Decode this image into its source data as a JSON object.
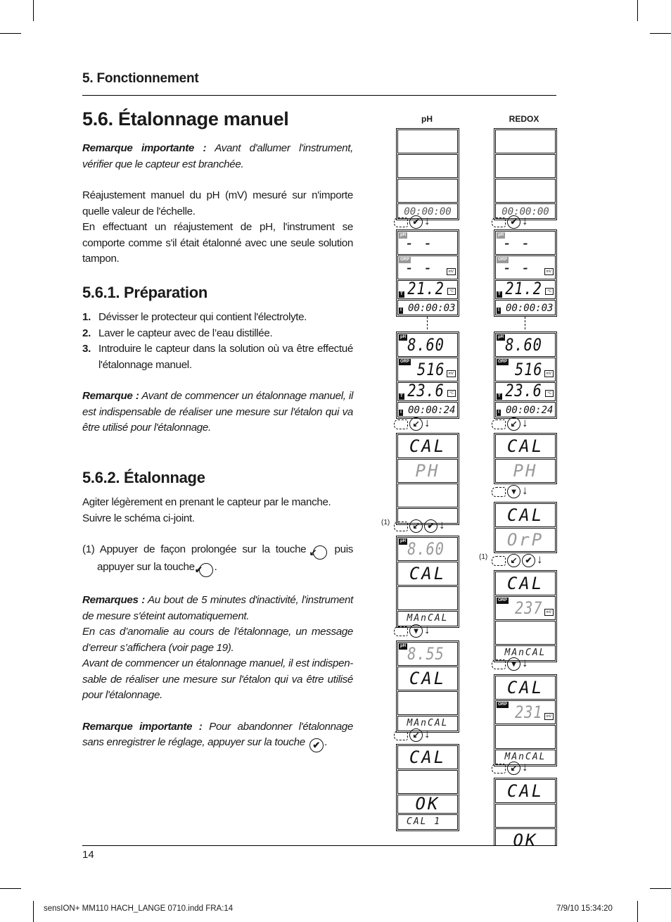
{
  "header": {
    "section": "5. Fonctionnement"
  },
  "title": "5.6. Étalonnage manuel",
  "intro": {
    "remark_lead": "Remarque importante :",
    "remark_text": " Avant d'allumer l'instrument, vérifier que le capteur est branchée.",
    "p1": "Réajustement manuel du pH (mV) mesuré sur n'importe quelle valeur de l'échelle.",
    "p2": "En effectuant un réajustement de pH, l'instrument se comporte comme s'il était étalonné avec une seule solution tampon."
  },
  "preparation": {
    "title": "5.6.1. Préparation",
    "steps": [
      {
        "num": "1.",
        "text": "Dévisser le protecteur qui contient l'électrolyte."
      },
      {
        "num": "2.",
        "text": "Laver le capteur avec de l’eau distillée."
      },
      {
        "num": "3.",
        "text": "Introduire le capteur dans la solution où va être effectué l'étalonnage manuel."
      }
    ],
    "remark_lead": "Remarque :",
    "remark_text": " Avant de commencer un étalonnage manuel, il est indispensable de réaliser une mesure sur l'étalon qui va être utilisé pour l'étalonnage."
  },
  "etalonnage": {
    "title": "5.6.2. Étalonnage",
    "p1": "Agiter légèrement en prenant le capteur par le manche.",
    "p2": "Suivre le schéma ci-joint.",
    "note1_a": "(1) Appuyer de façon prolongée sur la touche",
    "note1_b": "puis appuyer sur la touche",
    "note1_c": ".",
    "remarks_lead": "Remarques :",
    "remarks_1": " Au bout de 5 minutes d'inactivité, l'instrument de mesure s'éteint automatiquement.",
    "remarks_2": "En cas d’anomalie au cours de l'étalonnage, un message d’erreur s’affichera (voir page 19).",
    "remarks_3": "Avant de commencer un étalonnage manuel, il est indispen-sable de réaliser une mesure sur l'étalon qui va être utilisé pour l'étalonnage.",
    "important_lead": "Remarque importante :",
    "important_text": " Pour abandonner l'étalonnage sans enregistrer le réglage, appuyer sur la touche",
    "important_end": "."
  },
  "keys": {
    "cal": "↙",
    "ok": "✔",
    "down": "▾"
  },
  "diagram": {
    "ph_title": "pH",
    "redox_title": "REDOX",
    "time0": "00:00:00",
    "time3": "00:00:03",
    "time24": "00:00:24",
    "dashes": "- - -",
    "temp1": "21.2",
    "temp2": "23.6",
    "ph_val": "8.60",
    "ph_val2": "8.55",
    "orp_val": "516",
    "orp_cal1": "237",
    "orp_cal2": "231",
    "cal": "CAL",
    "ph_label": "PH",
    "orp_label": "OrP",
    "mancal": "MAnCAL",
    "ok": "OK",
    "cal1": "CAL 1",
    "tag_ph": "pH",
    "tag_orp": "ORP",
    "tag_t": "T",
    "tag_time": "t",
    "unit_mv": "mV",
    "unit_c": "°C",
    "note1": "(1)"
  },
  "footer": {
    "page_number": "14",
    "slug_left": "sensION+ MM110 HACH_LANGE 0710.indd   FRA:14",
    "slug_right": "7/9/10   15:34:20"
  }
}
